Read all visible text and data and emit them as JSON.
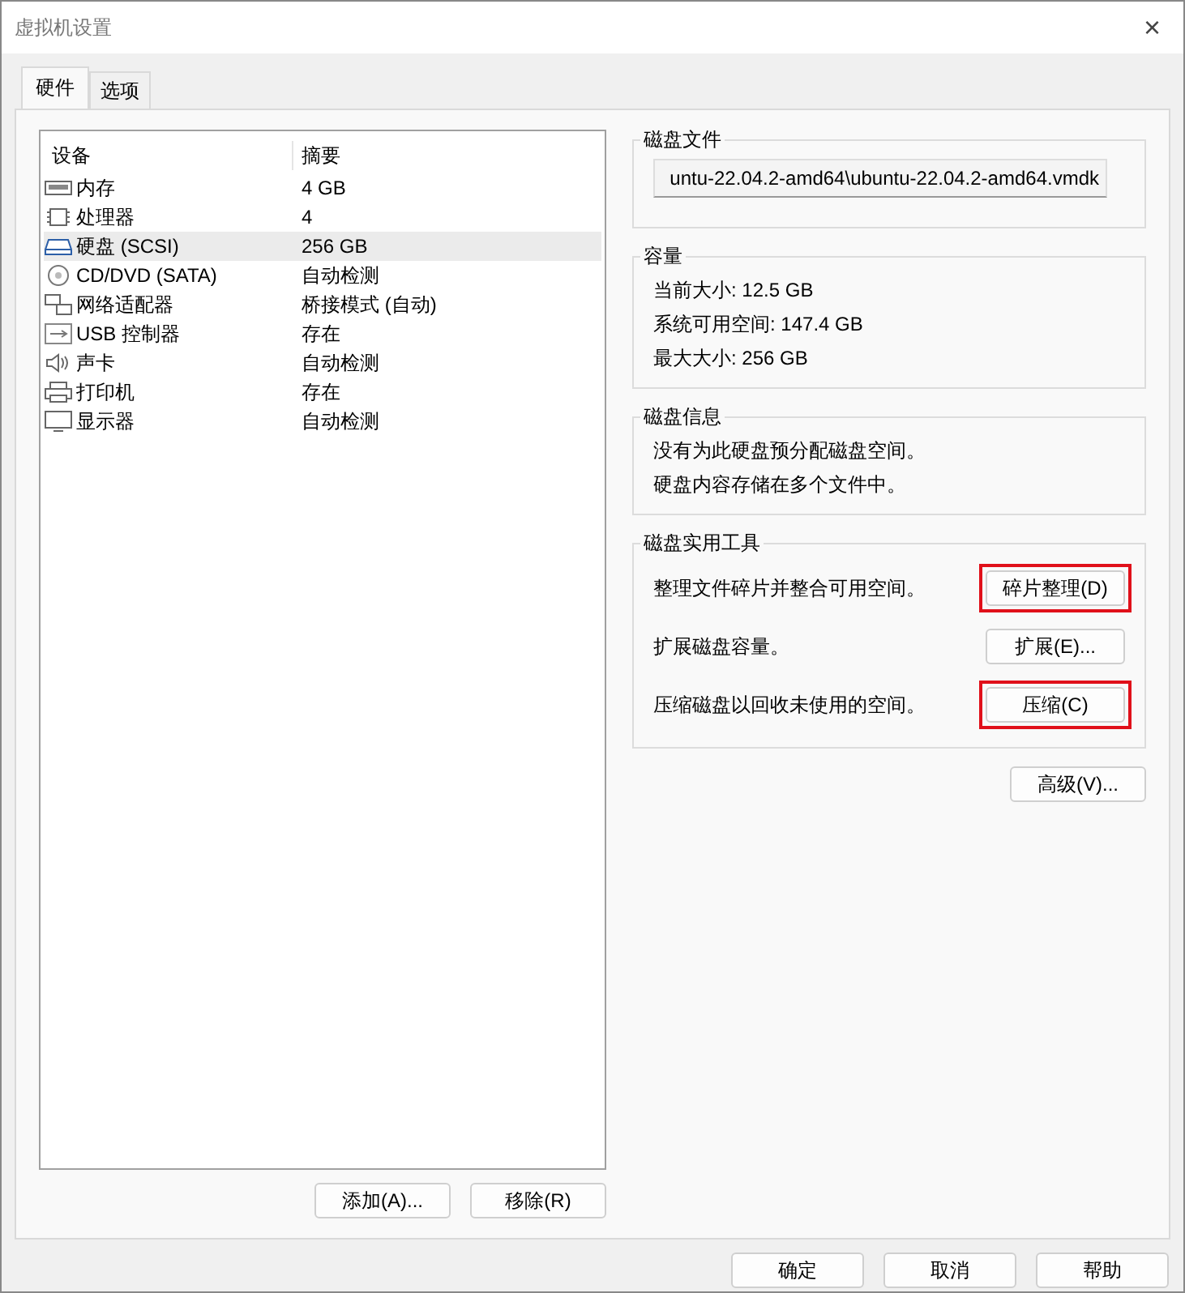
{
  "window": {
    "title": "虚拟机设置",
    "close": "×"
  },
  "tabs": [
    {
      "label": "硬件",
      "selected": true
    },
    {
      "label": "选项",
      "selected": false
    }
  ],
  "devices": {
    "columns": [
      "设备",
      "摘要"
    ],
    "rows": [
      {
        "kind": "memory",
        "name": "内存",
        "summary": "4 GB",
        "selected": false
      },
      {
        "kind": "cpu",
        "name": "处理器",
        "summary": "4",
        "selected": false
      },
      {
        "kind": "disk",
        "name": "硬盘 (SCSI)",
        "summary": "256 GB",
        "selected": true
      },
      {
        "kind": "cdrom",
        "name": "CD/DVD (SATA)",
        "summary": "自动检测",
        "selected": false
      },
      {
        "kind": "network",
        "name": "网络适配器",
        "summary": "桥接模式 (自动)",
        "selected": false
      },
      {
        "kind": "usb",
        "name": "USB 控制器",
        "summary": "存在",
        "selected": false
      },
      {
        "kind": "sound",
        "name": "声卡",
        "summary": "自动检测",
        "selected": false
      },
      {
        "kind": "printer",
        "name": "打印机",
        "summary": "存在",
        "selected": false
      },
      {
        "kind": "display",
        "name": "显示器",
        "summary": "自动检测",
        "selected": false
      }
    ],
    "buttons": [
      "添加(A)...",
      "移除(R)"
    ]
  },
  "disk_file": {
    "title": "磁盘文件",
    "value": "untu-22.04.2-amd64\\ubuntu-22.04.2-amd64.vmdk"
  },
  "capacity": {
    "title": "容量",
    "lines": [
      "当前大小: 12.5 GB",
      "系统可用空间: 147.4 GB",
      "最大大小: 256 GB"
    ]
  },
  "disk_info": {
    "title": "磁盘信息",
    "lines": [
      "没有为此硬盘预分配磁盘空间。",
      "硬盘内容存储在多个文件中。"
    ]
  },
  "utilities": {
    "title": "磁盘实用工具",
    "items": [
      {
        "text": "整理文件碎片并整合可用空间。",
        "button": "碎片整理(D)",
        "highlighted": true
      },
      {
        "text": "扩展磁盘容量。",
        "button": "扩展(E)...",
        "highlighted": false
      },
      {
        "text": "压缩磁盘以回收未使用的空间。",
        "button": "压缩(C)",
        "highlighted": true
      }
    ]
  },
  "advanced_button": "高级(V)...",
  "dialog_buttons": [
    "确定",
    "取消",
    "帮助"
  ]
}
